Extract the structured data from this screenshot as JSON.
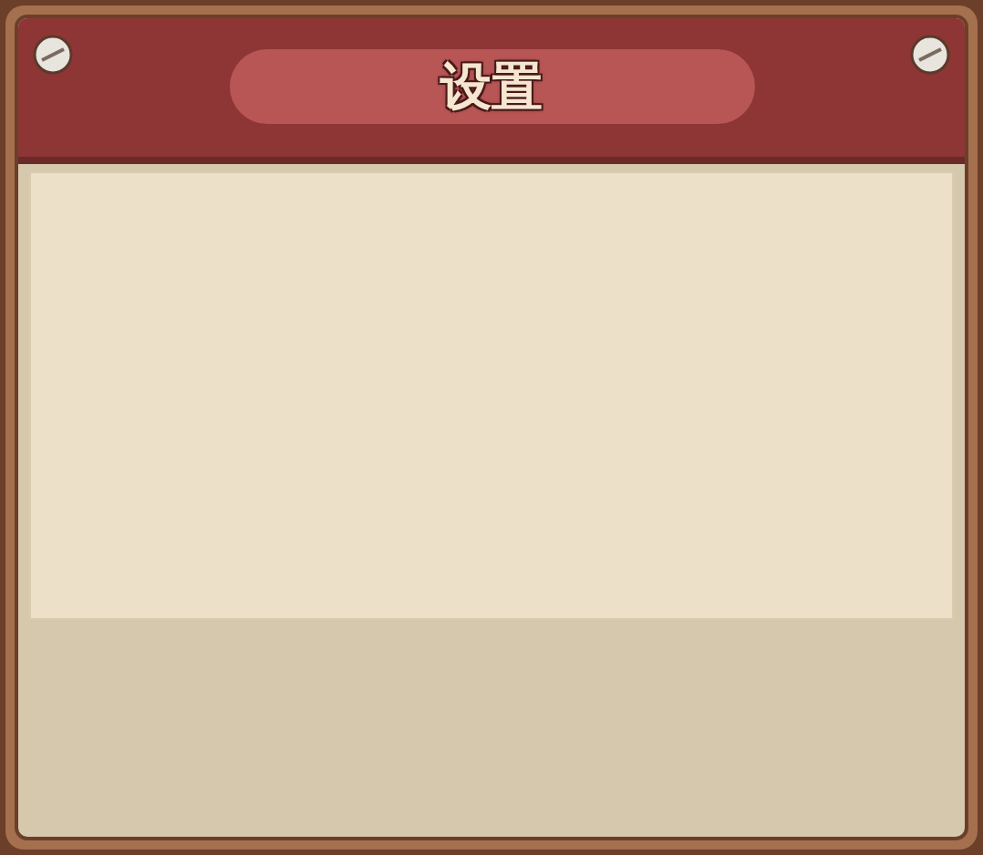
{
  "window": {
    "title": "设置"
  }
}
